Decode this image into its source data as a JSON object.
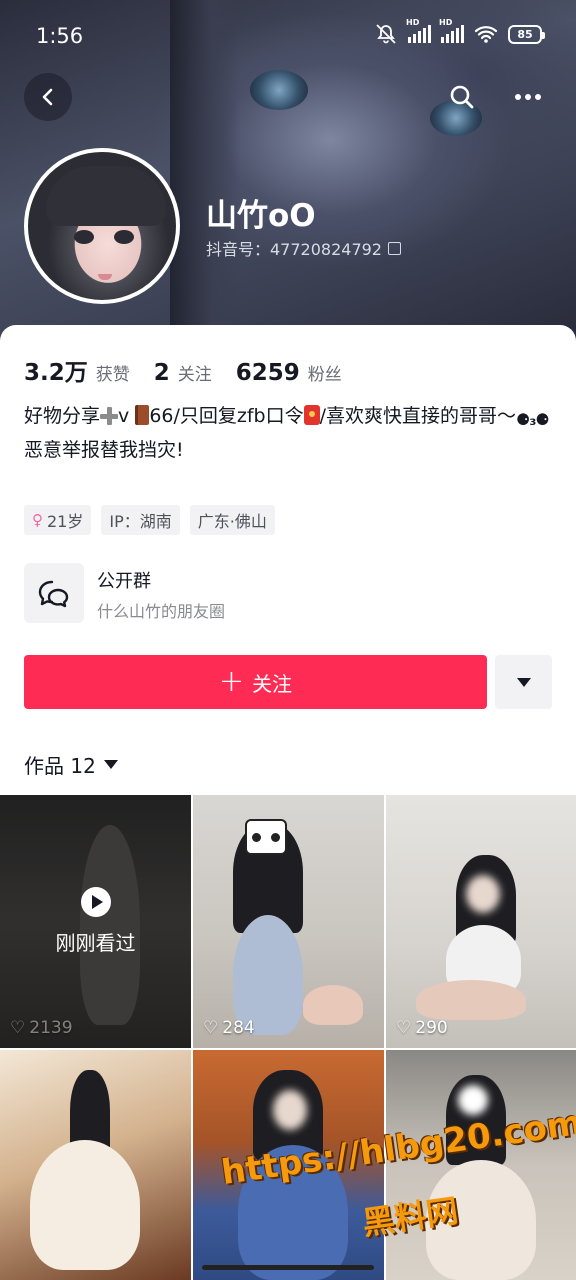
{
  "status_bar": {
    "time": "1:56",
    "battery": "85"
  },
  "profile": {
    "nickname": "山竹oO",
    "douyin_id": "抖音号：47720824792"
  },
  "stats": [
    {
      "value": "3.2万",
      "label": "获赞"
    },
    {
      "value": "2",
      "label": "关注"
    },
    {
      "value": "6259",
      "label": "粉丝"
    }
  ],
  "bio": {
    "seg1": "好物分享",
    "seg2": "v ",
    "seg3": "66/只回复zfb口令",
    "seg4": "/喜欢爽快直接的哥哥～",
    "seg5": "⚈₃⚈",
    "line2": "恶意举报替我挡灾!"
  },
  "tags": {
    "age": "21岁",
    "gender_symbol": "♀",
    "ip": "IP：湖南",
    "location": "广东·佛山"
  },
  "group": {
    "title": "公开群",
    "subtitle": "什么山竹的朋友圈"
  },
  "actions": {
    "follow_label": "关注",
    "follow_color": "#fe2c55"
  },
  "works_tab": {
    "label": "作品 12"
  },
  "videos": [
    {
      "likes": "2139",
      "overlay": "刚刚看过"
    },
    {
      "likes": "284"
    },
    {
      "likes": "290"
    },
    {
      "likes": ""
    },
    {
      "likes": ""
    },
    {
      "likes": ""
    }
  ],
  "watermark": {
    "url": "https://hlbg20.com",
    "name": "黑料网"
  },
  "icons": [
    "back-icon",
    "search-icon",
    "more-icon",
    "copy-icon",
    "group-chat-icon",
    "dropdown-icon",
    "play-icon",
    "heart-icon"
  ]
}
